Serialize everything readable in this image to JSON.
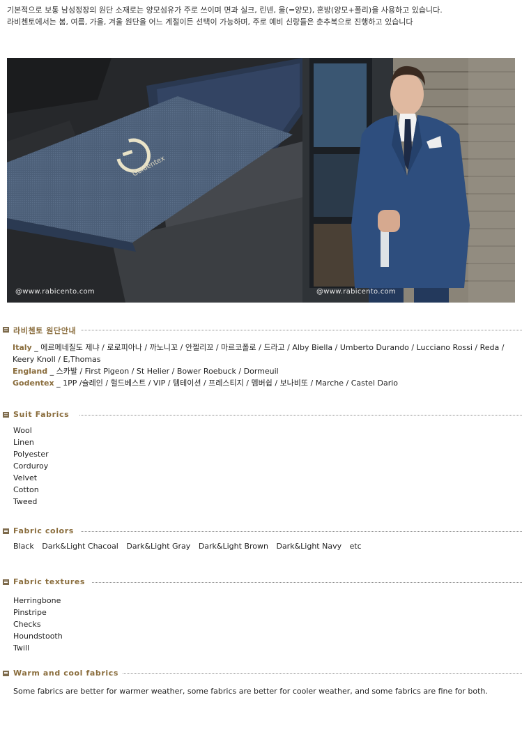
{
  "intro": {
    "line1": "기본적으로 보통 남성정장의 원단 소재로는 양모섬유가 주로 쓰이며 면과 실크, 린넨, 울(=양모), 혼방(양모+폴리)을 사용하고 있습니다.",
    "line2": "라비첸토에서는 봄, 여름, 가을, 겨울 원단을 어느 계절이든 선택이 가능하며, 주로 예비 신랑들은 춘추복으로 진행하고 있습니다"
  },
  "photos": {
    "left_watermark": "@www.rabicento.com",
    "right_watermark": "@www.rabicento.com",
    "left_label_brand": "Goldentex"
  },
  "fabric_guide": {
    "title": "라비첸토 원단안내",
    "italy_label": "Italy",
    "italy_text": " _ 에르메네질도 제냐 / 로로피아나 / 까노니꼬 / 안젤리꼬 / 마르코폴로 / 드라고 / Alby Biella / Umberto Durando / Lucciano Rossi / Reda / Keery Knoll / E,Thomas",
    "england_label": "England",
    "england_text": " _ 스카발 / First Pigeon / St Helier / Bower Roebuck / Dormeuil",
    "goldentex_label": "Godentex",
    "goldentex_text": " _ 1PP /슐레인 / 헐드베스트 / VIP / 템테이션 / 프레스티지 / 멤버쉽 / 보나비또 / Marche / Castel Dario"
  },
  "suit_fabrics": {
    "title": "Suit Fabrics",
    "items": [
      "Wool",
      "Linen",
      "Polyester",
      "Corduroy",
      "Velvet",
      "Cotton",
      "Tweed"
    ]
  },
  "fabric_colors": {
    "title": "Fabric colors",
    "items": [
      "Black",
      "Dark&Light Chacoal",
      "Dark&Light Gray",
      "Dark&Light Brown",
      " Dark&Light Navy",
      "etc"
    ]
  },
  "fabric_textures": {
    "title": "Fabric textures",
    "items": [
      "Herringbone",
      "Pinstripe",
      "Checks",
      "Houndstooth",
      "Twill"
    ]
  },
  "warm_cool": {
    "title": "Warm and cool fabrics",
    "text": "Some fabrics are better for warmer weather, some fabrics are better for cooler weather, and some fabrics are fine for both."
  },
  "colors": {
    "accent": "#8a6d3d",
    "bullet": "#7d6a4b",
    "text": "#222222"
  }
}
